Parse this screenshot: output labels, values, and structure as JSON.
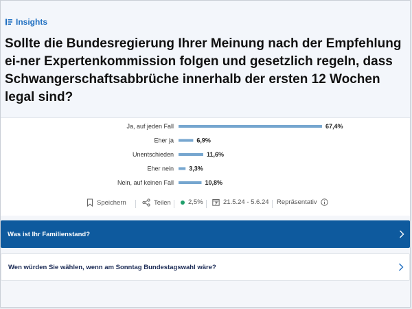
{
  "header": {
    "section_label": "Insights",
    "section_icon": "insights-list-icon",
    "question": "Sollte die Bundesregierung Ihrer Meinung nach der Empfehlung ei-ner Expertenkommission folgen und gesetzlich regeln, dass Schwangerschaftsabbrüche innerhalb der ersten 12 Wochen legal sind?"
  },
  "chart_data": {
    "type": "bar",
    "orientation": "horizontal",
    "categories": [
      "Ja, auf jeden Fall",
      "Eher ja",
      "Unentschieden",
      "Eher nein",
      "Nein, auf keinen Fall"
    ],
    "values": [
      67.4,
      6.9,
      11.6,
      3.3,
      10.8
    ],
    "value_labels": [
      "67,4%",
      "6,9%",
      "11,6%",
      "3,3%",
      "10,8%"
    ],
    "xlim": [
      0,
      100
    ],
    "bar_color": "#76a6cf",
    "grid": false
  },
  "actions": {
    "save_label": "Speichern",
    "share_label": "Teilen",
    "margin_value": "2,5%",
    "margin_dot_color": "#1f9f6b",
    "date_range": "21.5.24 - 5.6.24",
    "representative_label": "Repräsentativ"
  },
  "nav": {
    "item1": "Was ist Ihr Familienstand?",
    "item2": "Wen würden Sie wählen, wenn am Sonntag Bundestagswahl wäre?",
    "active_color": "#0e5a9e"
  }
}
